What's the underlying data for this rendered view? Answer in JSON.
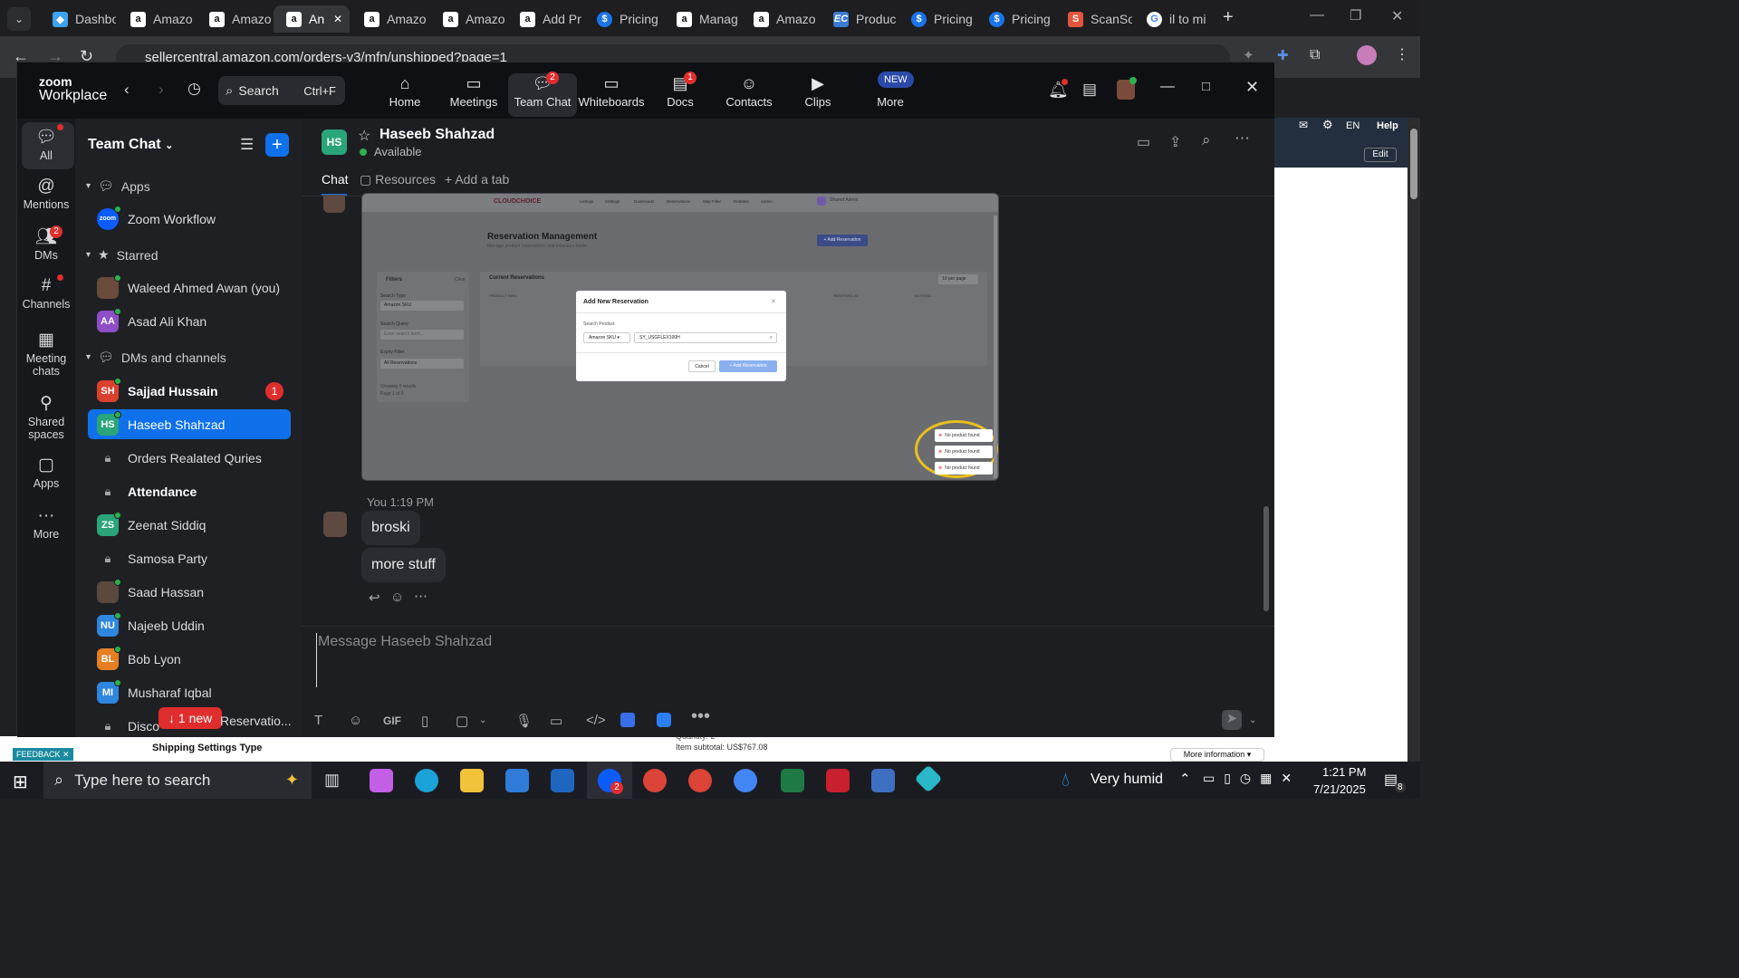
{
  "browser": {
    "tabs": [
      {
        "icon": "dashboard-favicon",
        "label": "Dashbo"
      },
      {
        "icon": "amazon-favicon",
        "label": "Amazo"
      },
      {
        "icon": "amazon-favicon",
        "label": "Amazo"
      },
      {
        "icon": "amazon-favicon",
        "label": "An"
      },
      {
        "icon": "amazon-favicon",
        "label": "Amazo"
      },
      {
        "icon": "amazon-favicon",
        "label": "Amazo"
      },
      {
        "icon": "amazon-favicon",
        "label": "Add Pr"
      },
      {
        "icon": "pricing-favicon",
        "label": "Pricing"
      },
      {
        "icon": "amazon-favicon",
        "label": "Manag"
      },
      {
        "icon": "amazon-favicon",
        "label": "Amazo"
      },
      {
        "icon": "ec-favicon",
        "label": "Produc"
      },
      {
        "icon": "pricing-favicon",
        "label": "Pricing"
      },
      {
        "icon": "pricing-favicon",
        "label": "Pricing"
      },
      {
        "icon": "scansource-favicon",
        "label": "ScanSo"
      },
      {
        "icon": "google-favicon",
        "label": "il to mi"
      }
    ],
    "url": "sellercentral.amazon.com/orders-v3/mfn/unshipped?page=1"
  },
  "zoom": {
    "logo_line1": "zoom",
    "logo_line2": "Workplace",
    "search_label": "Search",
    "search_shortcut": "Ctrl+F",
    "nav": [
      {
        "label": "Home",
        "icon": "home-icon",
        "badge": ""
      },
      {
        "label": "Meetings",
        "icon": "video-icon",
        "badge": ""
      },
      {
        "label": "Team Chat",
        "icon": "chat-icon",
        "badge": "2"
      },
      {
        "label": "Whiteboards",
        "icon": "whiteboard-icon",
        "badge": ""
      },
      {
        "label": "Docs",
        "icon": "docs-icon",
        "badge": "1"
      },
      {
        "label": "Contacts",
        "icon": "contacts-icon",
        "badge": ""
      },
      {
        "label": "Clips",
        "icon": "clips-icon",
        "badge": ""
      },
      {
        "label": "More",
        "icon": "more-icon",
        "badge": "NEW"
      }
    ],
    "rail": [
      {
        "label": "All",
        "icon": "all-chats-icon",
        "badge": ""
      },
      {
        "label": "Mentions",
        "icon": "at-icon",
        "badge": ""
      },
      {
        "label": "DMs",
        "icon": "dms-icon",
        "badge": "2"
      },
      {
        "label": "Channels",
        "icon": "hash-icon",
        "badge": ""
      },
      {
        "label": "Meeting chats",
        "icon": "calendar-icon",
        "badge": ""
      },
      {
        "label": "Shared spaces",
        "icon": "shared-icon",
        "badge": ""
      },
      {
        "label": "Apps",
        "icon": "apps-icon",
        "badge": ""
      },
      {
        "label": "More",
        "icon": "ellipsis-icon",
        "badge": ""
      }
    ],
    "sidebar": {
      "title": "Team Chat",
      "sections": {
        "apps": "Apps",
        "starred": "Starred",
        "dms": "DMs and channels"
      },
      "apps_items": [
        {
          "name": "Zoom Workflow",
          "avatar": "zoom"
        }
      ],
      "starred_items": [
        {
          "name": "Waleed Ahmed Awan (you)",
          "avatar": "",
          "color": "#6b4b3b"
        },
        {
          "name": "Asad Ali Khan",
          "avatar": "AA",
          "color": "#8e4ec6"
        }
      ],
      "channel_items": [
        {
          "name": "Sajjad Hussain",
          "avatar": "SH",
          "color": "#d9412f",
          "bold": true,
          "lock": false,
          "unread": "1"
        },
        {
          "name": "Haseeb Shahzad",
          "avatar": "HS",
          "color": "#2aa57a",
          "bold": false,
          "lock": false,
          "unread": ""
        },
        {
          "name": "Orders Realated Quries",
          "avatar": "",
          "color": "",
          "bold": false,
          "lock": true,
          "unread": ""
        },
        {
          "name": "Attendance",
          "avatar": "",
          "color": "",
          "bold": true,
          "lock": true,
          "unread": ""
        },
        {
          "name": "Zeenat Siddiq",
          "avatar": "ZS",
          "color": "#2aa57a",
          "bold": false,
          "lock": false,
          "unread": ""
        },
        {
          "name": "Samosa Party",
          "avatar": "",
          "color": "",
          "bold": false,
          "lock": true,
          "unread": ""
        },
        {
          "name": "Saad Hassan",
          "avatar": "",
          "color": "#5a4a3e",
          "bold": false,
          "lock": false,
          "unread": ""
        },
        {
          "name": "Najeeb Uddin",
          "avatar": "NU",
          "color": "#2e86de",
          "bold": false,
          "lock": false,
          "unread": ""
        },
        {
          "name": "Bob Lyon",
          "avatar": "BL",
          "color": "#e67e22",
          "bold": false,
          "lock": false,
          "unread": ""
        },
        {
          "name": "Musharaf Iqbal",
          "avatar": "MI",
          "color": "#2e86de",
          "bold": false,
          "lock": false,
          "unread": ""
        },
        {
          "name": "Disco",
          "avatar": "",
          "color": "",
          "bold": false,
          "lock": true,
          "unread": ""
        }
      ],
      "last_item_suffix": "Reservatio...",
      "new_pill": "1 new"
    },
    "chat": {
      "contact_initials": "HS",
      "contact_name": "Haseeb Shahzad",
      "status": "Available",
      "tabs": [
        "Chat",
        "Resources",
        "Add a tab"
      ],
      "screenshot": {
        "brand": "CLOUDCHOICE",
        "nav": [
          "Listings",
          "Settings",
          "Downloads",
          "Reservations",
          "Map Filter",
          "Rebates",
          "Admin"
        ],
        "user": "Shared Admin",
        "page_title": "Reservation Management",
        "page_sub": "Manage product reservations and inventory holds",
        "add_button": "+ Add Reservation",
        "filters_title": "Filters",
        "filters_clear": "Clear",
        "search_type_label": "Search Type",
        "search_type_value": "Amazon SKU",
        "search_query_label": "Search Query",
        "search_query_placeholder": "Enter search term...",
        "expiry_label": "Expiry Filter",
        "expiry_value": "All Reservations",
        "showing": "Showing 0 results",
        "page_info": "Page 1 of 0",
        "current_title": "Current Reservations",
        "per_page": "10 per page",
        "col_product": "PRODUCT INFO",
        "col_reserved": "RESERVED AT",
        "col_actions": "ACTIONS",
        "modal_title": "Add New Reservation",
        "modal_label": "Search Product",
        "modal_select": "Amazon SKU",
        "modal_input": "SY_USGFLEX100H",
        "modal_cancel": "Cancel",
        "modal_add": "+ Add Reservation",
        "toasts": [
          "No product found",
          "No product found",
          "No product found"
        ]
      },
      "meta": "You 1:19 PM",
      "messages": [
        "broski",
        "more stuff"
      ],
      "composer_placeholder": "Message Haseeb Shahzad",
      "gif_label": "GIF"
    }
  },
  "behind": {
    "left_text": "Shipping Settings Type",
    "subtotal": "Item subtotal: US$767.08",
    "quantity": "Quantity: 2",
    "more_info": "More information",
    "feedback": "FEEDBACK",
    "lang": "EN",
    "help": "Help",
    "edit": "Edit"
  },
  "taskbar": {
    "search_placeholder": "Type here to search",
    "weather": "Very humid",
    "time": "1:21 PM",
    "date": "7/21/2025",
    "notif_count": "8",
    "zoom_badge": "2"
  }
}
